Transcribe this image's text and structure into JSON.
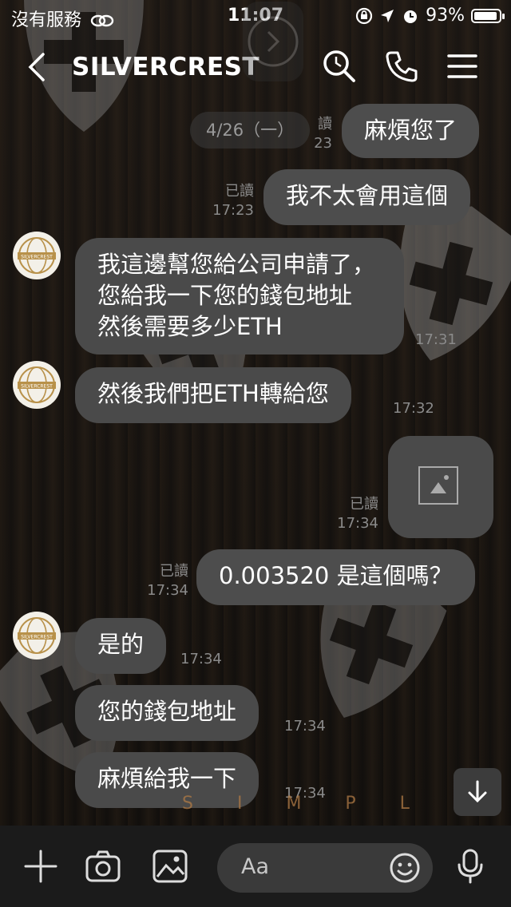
{
  "status_bar": {
    "carrier": "沒有服務",
    "time": "11:07",
    "battery_text": "93%",
    "battery_level": 0.93
  },
  "header": {
    "title": "SILVERCREST",
    "back_icon": "chevron-left-icon",
    "search_icon": "search-icon",
    "call_icon": "phone-icon",
    "menu_icon": "hamburger-menu-icon"
  },
  "date_chip": "4/26（一）",
  "messages": [
    {
      "side": "me",
      "text": "麻煩您了",
      "read": "讀",
      "time": "23"
    },
    {
      "side": "me",
      "text": "我不太會用這個",
      "read": "已讀",
      "time": "17:23"
    },
    {
      "side": "them",
      "text": "我這邊幫您給公司申請了，您給我一下您的錢包地址 然後需要多少ETH",
      "time": "17:31"
    },
    {
      "side": "them",
      "text": "然後我們把ETH轉給您",
      "time": "17:32"
    },
    {
      "side": "me",
      "type": "image",
      "read": "已讀",
      "time": "17:34"
    },
    {
      "side": "me",
      "text": "0.003520 是這個嗎？",
      "read": "已讀",
      "time": "17:34"
    },
    {
      "side": "them",
      "text": "是的",
      "time": "17:34"
    },
    {
      "side": "them",
      "text": "您的錢包地址",
      "time": "17:34"
    },
    {
      "side": "them",
      "text": "麻煩給我一下",
      "time": "17:34"
    }
  ],
  "watermark": "S I M P L E",
  "input_bar": {
    "placeholder": "Aa",
    "icons": [
      "plus-icon",
      "camera-icon",
      "image-icon",
      "emoji-icon",
      "microphone-icon"
    ]
  },
  "avatar_label": "SILVERCREST"
}
